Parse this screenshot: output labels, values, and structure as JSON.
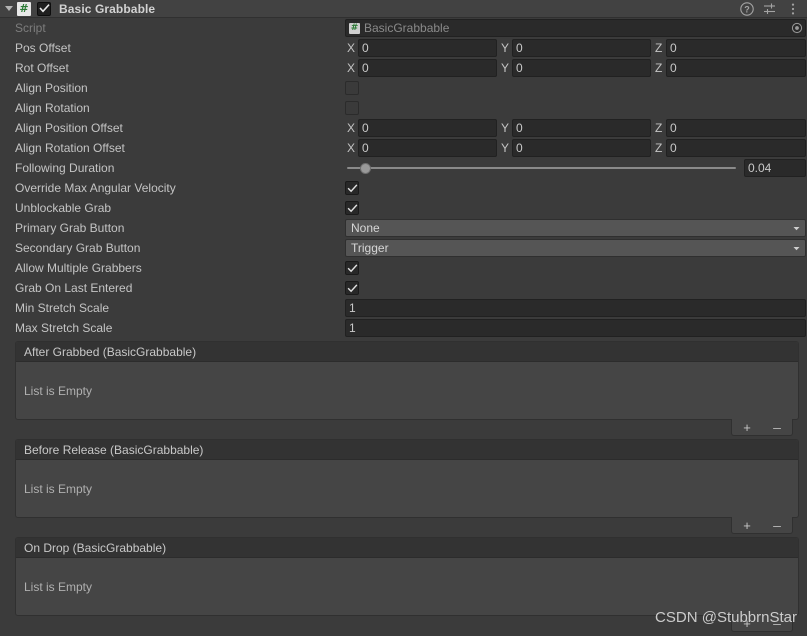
{
  "header": {
    "title": "Basic Grabbable",
    "script_icon": "csharp-script-icon",
    "script_icon_glyph": "#",
    "enabled": true,
    "foldout_expanded": true,
    "help_icon": "help-icon",
    "preset_icon": "preset-icon",
    "menu_icon": "more-menu-icon"
  },
  "script_row": {
    "label": "Script",
    "value": "BasicGrabbable",
    "icon": "script-asset-icon",
    "icon_glyph": "#",
    "picker_icon": "object-picker-icon"
  },
  "vector_rows": [
    {
      "label": "Pos Offset",
      "axes": [
        {
          "axis": "X",
          "value": "0"
        },
        {
          "axis": "Y",
          "value": "0"
        },
        {
          "axis": "Z",
          "value": "0"
        }
      ]
    },
    {
      "label": "Rot Offset",
      "axes": [
        {
          "axis": "X",
          "value": "0"
        },
        {
          "axis": "Y",
          "value": "0"
        },
        {
          "axis": "Z",
          "value": "0"
        }
      ]
    },
    {
      "label": "Align Position Offset",
      "axes": [
        {
          "axis": "X",
          "value": "0"
        },
        {
          "axis": "Y",
          "value": "0"
        },
        {
          "axis": "Z",
          "value": "0"
        }
      ]
    },
    {
      "label": "Align Rotation Offset",
      "axes": [
        {
          "axis": "X",
          "value": "0"
        },
        {
          "axis": "Y",
          "value": "0"
        },
        {
          "axis": "Z",
          "value": "0"
        }
      ]
    }
  ],
  "toggles": {
    "align_position": {
      "label": "Align Position",
      "checked": false
    },
    "align_rotation": {
      "label": "Align Rotation",
      "checked": false
    },
    "override_max_angular_velocity": {
      "label": "Override Max Angular Velocity",
      "checked": true
    },
    "unblockable_grab": {
      "label": "Unblockable Grab",
      "checked": true
    },
    "allow_multiple_grabbers": {
      "label": "Allow Multiple Grabbers",
      "checked": true
    },
    "grab_on_last_entered": {
      "label": "Grab On Last Entered",
      "checked": true
    }
  },
  "slider_row": {
    "label": "Following Duration",
    "value": "0.04",
    "fill_percent": 5
  },
  "dropdowns": [
    {
      "label": "Primary Grab Button",
      "value": "None",
      "arrow_icon": "chevron-down-icon"
    },
    {
      "label": "Secondary Grab Button",
      "value": "Trigger",
      "arrow_icon": "chevron-down-icon"
    }
  ],
  "number_rows": [
    {
      "label": "Min Stretch Scale",
      "value": "1"
    },
    {
      "label": "Max Stretch Scale",
      "value": "1"
    }
  ],
  "event_lists": [
    {
      "title": "After Grabbed (BasicGrabbable)",
      "empty_text": "List is Empty",
      "add_label": "+",
      "remove_label": "–"
    },
    {
      "title": "Before Release (BasicGrabbable)",
      "empty_text": "List is Empty",
      "add_label": "+",
      "remove_label": "–"
    },
    {
      "title": "On Drop (BasicGrabbable)",
      "empty_text": "List is Empty",
      "add_label": "+",
      "remove_label": "–"
    }
  ],
  "watermark": {
    "text": "CSDN @StubbrnStar"
  },
  "colors": {
    "window_bg": "#3b3b3b",
    "header_bg": "#424242",
    "field_bg": "#2a2a2a",
    "dropdown_bg": "#555555",
    "event_box_bg": "#454545",
    "event_head_bg": "#333333",
    "text": "#c4c4c4",
    "text_disabled": "#7d7d7d"
  }
}
